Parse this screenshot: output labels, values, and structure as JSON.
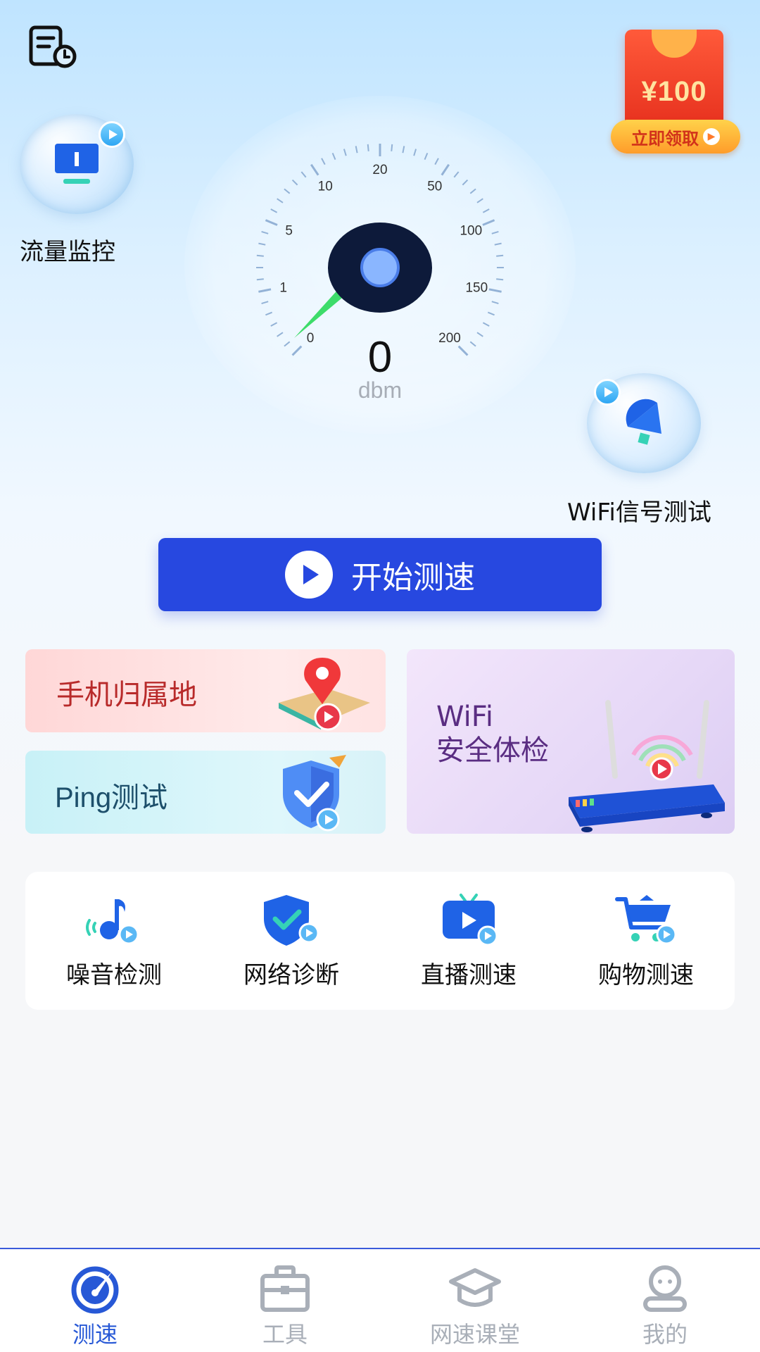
{
  "header": {
    "history_icon": "history-list-icon",
    "red_packet": {
      "amount": "¥100",
      "claim_label": "立即领取",
      "coin_symbol": "¥"
    }
  },
  "shortcuts": {
    "flow_monitor": {
      "label": "流量监控",
      "icon": "monitor-icon"
    },
    "wifi_signal_test": {
      "label": "WiFi信号测试",
      "icon": "satellite-dish-icon"
    }
  },
  "gauge": {
    "tick_labels": [
      "0",
      "1",
      "5",
      "10",
      "20",
      "50",
      "100",
      "150",
      "200"
    ],
    "value": "0",
    "unit": "dbm"
  },
  "start_button": {
    "label": "开始测速"
  },
  "feature_cards": {
    "phone_location": {
      "label": "手机归属地"
    },
    "ping_test": {
      "label": "Ping测试"
    },
    "wifi_check": {
      "line1": "WiFi",
      "line2": "安全体检"
    }
  },
  "tools": [
    {
      "label": "噪音检测",
      "icon": "music-note-icon"
    },
    {
      "label": "网络诊断",
      "icon": "shield-check-icon"
    },
    {
      "label": "直播测速",
      "icon": "live-tv-icon"
    },
    {
      "label": "购物测速",
      "icon": "shopping-cart-icon"
    }
  ],
  "bottom_nav": [
    {
      "label": "测速",
      "icon": "speedometer-icon",
      "active": true
    },
    {
      "label": "工具",
      "icon": "toolbox-icon",
      "active": false
    },
    {
      "label": "网速课堂",
      "icon": "graduation-cap-icon",
      "active": false
    },
    {
      "label": "我的",
      "icon": "profile-icon",
      "active": false
    }
  ],
  "colors": {
    "primary_blue": "#2748e0",
    "nav_active": "#2758d6",
    "nav_inactive": "#a9afb8",
    "red_packet": "#e52e1c",
    "gauge_needle_green": "#3ddc6a"
  }
}
